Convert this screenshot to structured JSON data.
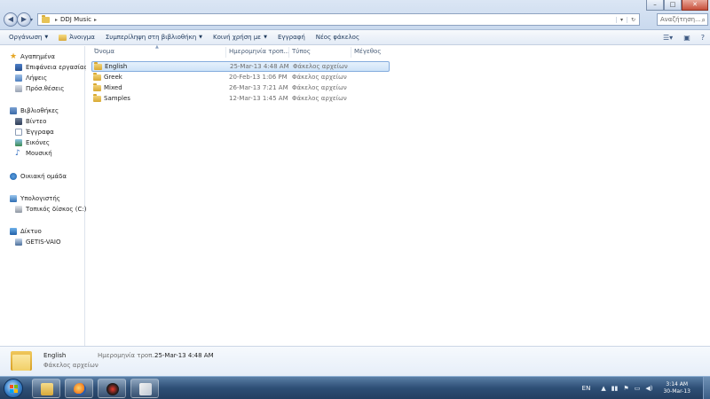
{
  "window": {
    "controls": {
      "minimize": "–",
      "maximize": "□",
      "close": "✕"
    }
  },
  "address_bar": {
    "back_icon": "back-arrow-icon",
    "forward_icon": "forward-arrow-icon",
    "path": [
      "DDJ Music"
    ],
    "dropdown_glyph": "▾",
    "refresh_glyph": "↻"
  },
  "search": {
    "placeholder": "Αναζήτηση..."
  },
  "toolbar": {
    "items": [
      {
        "label": "Οργάνωση",
        "dropdown": true
      },
      {
        "label": "Άνοιγμα",
        "dropdown": false
      },
      {
        "label": "Συμπερίληψη στη βιβλιοθήκη",
        "dropdown": true
      },
      {
        "label": "Κοινή χρήση με",
        "dropdown": true
      },
      {
        "label": "Εγγραφή",
        "dropdown": false
      },
      {
        "label": "Νέος φάκελος",
        "dropdown": false
      }
    ]
  },
  "nav": {
    "favorites": {
      "label": "Αγαπημένα",
      "items": [
        {
          "label": "Επιφάνεια εργασίας",
          "icon": "desktop-icon"
        },
        {
          "label": "Λήψεις",
          "icon": "downloads-icon"
        },
        {
          "label": "Πρόσ.θέσεις",
          "icon": "recent-places-icon"
        }
      ]
    },
    "libraries": {
      "label": "Βιβλιοθήκες",
      "items": [
        {
          "label": "Βίντεο",
          "icon": "videos-icon"
        },
        {
          "label": "Έγγραφα",
          "icon": "documents-icon"
        },
        {
          "label": "Εικόνες",
          "icon": "pictures-icon"
        },
        {
          "label": "Μουσική",
          "icon": "music-icon"
        }
      ]
    },
    "homegroup": {
      "label": "Οικιακή ομάδα"
    },
    "computer": {
      "label": "Υπολογιστής",
      "items": [
        {
          "label": "Τοπικός δίσκος (C:)",
          "icon": "local-disk-icon"
        }
      ]
    },
    "network": {
      "label": "Δίκτυο",
      "items": [
        {
          "label": "GETIS-VAIO",
          "icon": "computer-icon"
        }
      ]
    }
  },
  "columns": {
    "name": "Όνομα",
    "date": "Ημερομηνία τροπ...",
    "type": "Τύπος",
    "size": "Μέγεθος"
  },
  "files": [
    {
      "name": "English",
      "date": "25-Mar-13 4:48 AM",
      "type": "Φάκελος αρχείων",
      "selected": true
    },
    {
      "name": "Greek",
      "date": "20-Feb-13 1:06 PM",
      "type": "Φάκελος αρχείων",
      "selected": false
    },
    {
      "name": "Mixed",
      "date": "26-Mar-13 7:21 AM",
      "type": "Φάκελος αρχείων",
      "selected": false
    },
    {
      "name": "Samples",
      "date": "12-Mar-13 1:45 AM",
      "type": "Φάκελος αρχείων",
      "selected": false
    }
  ],
  "details": {
    "name": "English",
    "type": "Φάκελος αρχείων",
    "date_label": "Ημερομηνία τροπ...",
    "date_value": "25-Mar-13 4:48 AM"
  },
  "taskbar": {
    "apps": [
      {
        "name": "windows-explorer",
        "icon": "folder-icon"
      },
      {
        "name": "firefox",
        "icon": "firefox-icon"
      },
      {
        "name": "dj-app",
        "icon": "dj-app-icon"
      },
      {
        "name": "paint",
        "icon": "paint-icon"
      }
    ],
    "language": "EN",
    "time": "3:14 AM",
    "date": "30-Mar-13"
  }
}
